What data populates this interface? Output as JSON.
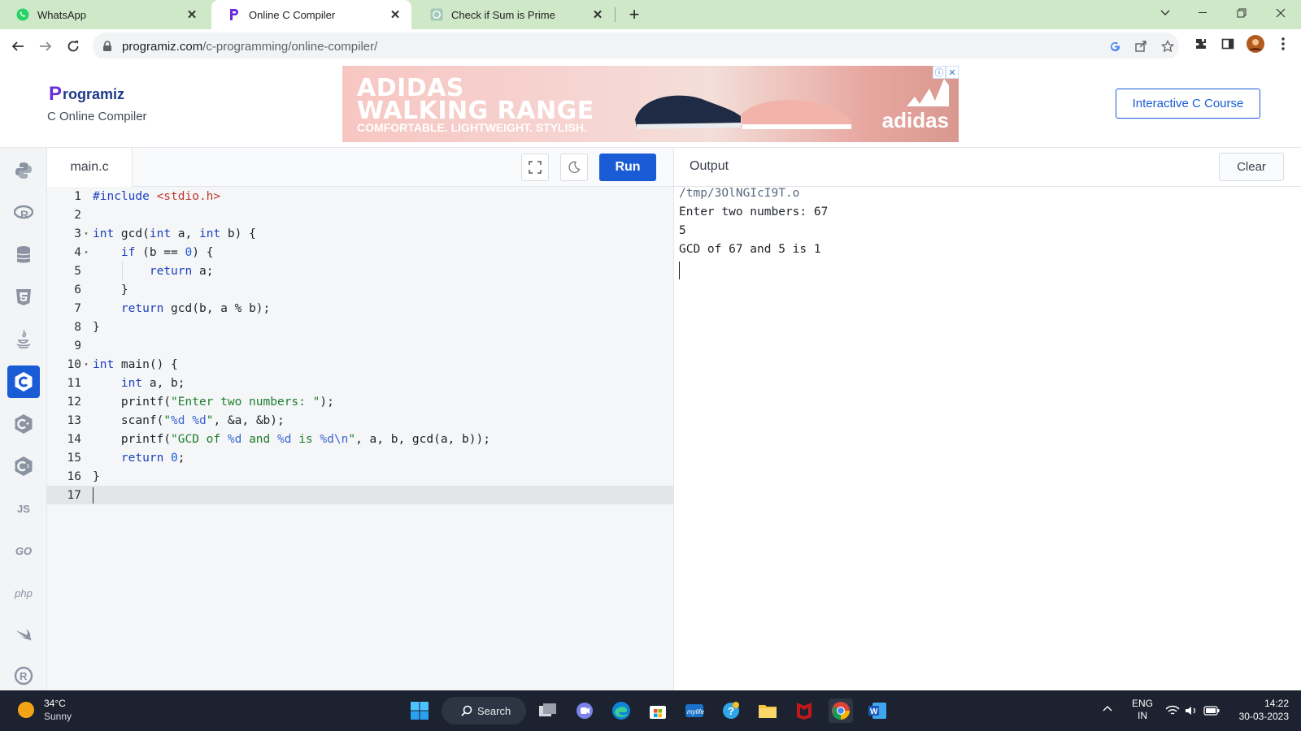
{
  "browser": {
    "tabs": [
      {
        "title": "WhatsApp",
        "icon": "whatsapp-icon"
      },
      {
        "title": "Online C Compiler",
        "icon": "programiz-icon",
        "active": true
      },
      {
        "title": "Check if Sum is Prime",
        "icon": "chatgpt-icon"
      }
    ],
    "url_host": "programiz.com",
    "url_path": "/c-programming/online-compiler/"
  },
  "site": {
    "logo_text": "rogramiz",
    "logo_letter": "P",
    "subtitle": "C Online Compiler",
    "course_button": "Interactive C Course",
    "ad": {
      "line1": "ADIDAS",
      "line2": "WALKING RANGE",
      "line3": "COMFORTABLE. LIGHTWEIGHT. STYLISH.",
      "brand": "adidas"
    }
  },
  "languages": [
    "python",
    "r",
    "sql",
    "html",
    "java",
    "c",
    "c++",
    "c#",
    "JS",
    "GO",
    "php",
    "swift",
    "rust"
  ],
  "editor": {
    "filename": "main.c",
    "run_label": "Run"
  },
  "code_lines": [
    "#include <stdio.h>",
    "",
    "int gcd(int a, int b) {",
    "    if (b == 0) {",
    "        return a;",
    "    }",
    "    return gcd(b, a % b);",
    "}",
    "",
    "int main() {",
    "    int a, b;",
    "    printf(\"Enter two numbers: \");",
    "    scanf(\"%d %d\", &a, &b);",
    "    printf(\"GCD of %d and %d is %d\\n\", a, b, gcd(a, b));",
    "    return 0;",
    "}",
    ""
  ],
  "output": {
    "title": "Output",
    "clear_label": "Clear",
    "lines": [
      "/tmp/3OlNGIcI9T.o",
      "Enter two numbers: 67",
      "5",
      "GCD of 67 and 5 is 1"
    ]
  },
  "taskbar": {
    "temperature": "34°C",
    "weather": "Sunny",
    "search_label": "Search",
    "lang_top": "ENG",
    "lang_bottom": "IN",
    "time": "14:22",
    "date": "30-03-2023"
  },
  "colors": {
    "accent": "#1a5bd6",
    "tabstrip": "#cfe8c8",
    "taskbar": "#1c2230"
  }
}
